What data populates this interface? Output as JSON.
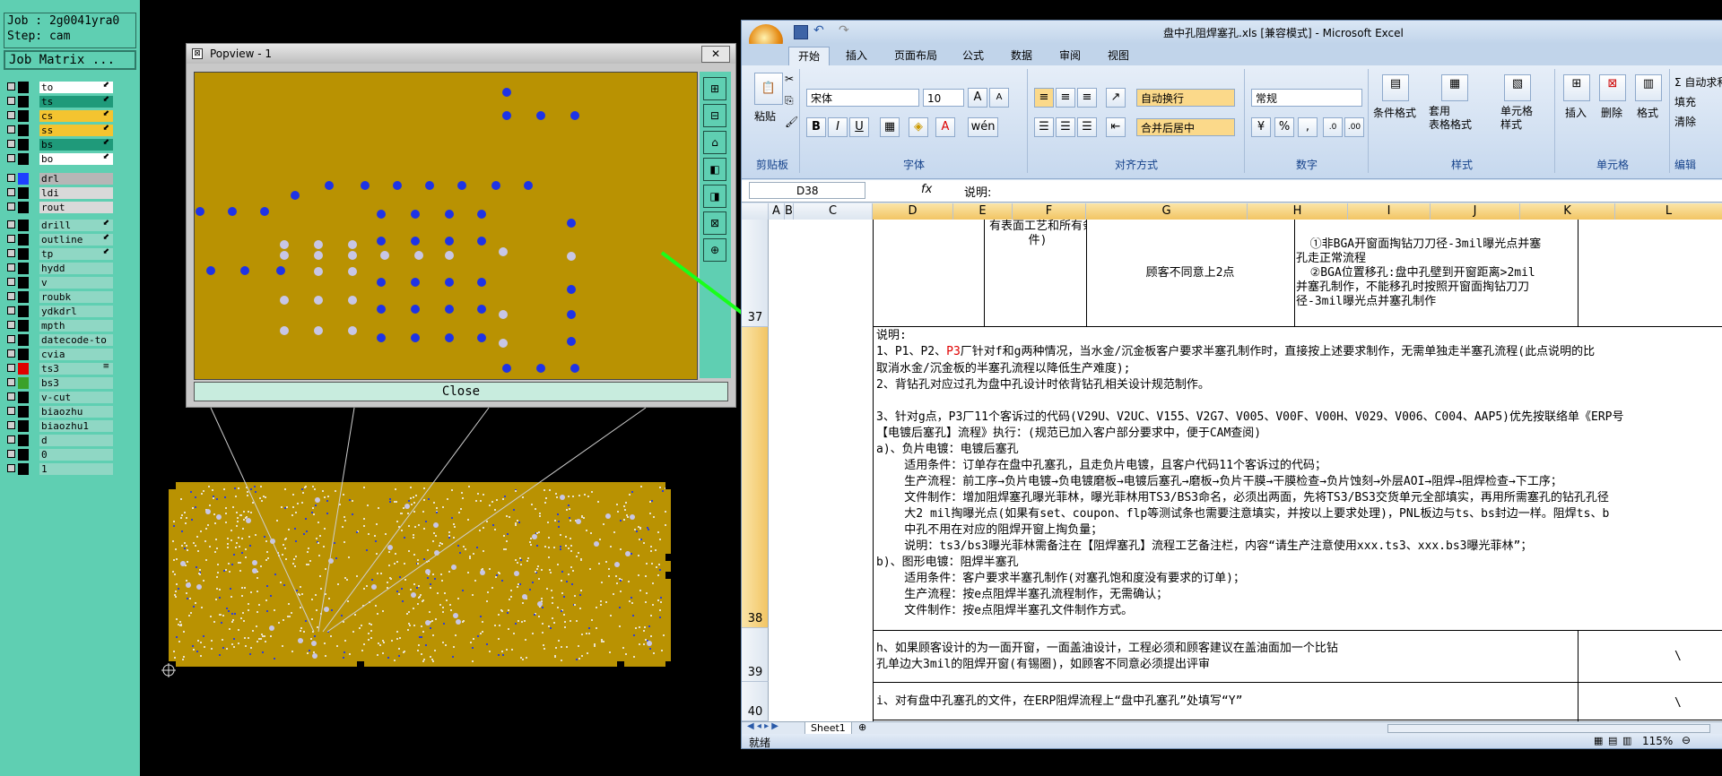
{
  "left_panel": {
    "job_label": "Job : 2g0041yra0",
    "step_label": "Step: cam",
    "job_matrix_label": "Job Matrix ...",
    "layers": [
      {
        "name": "to",
        "color": "#ffffff",
        "swatch": "#000000",
        "flag": "⬋"
      },
      {
        "name": "ts",
        "color": "#1f9a7a",
        "swatch": "#000000",
        "flag": "⬋"
      },
      {
        "name": "cs",
        "color": "#f4c430",
        "swatch": "#000000",
        "flag": "⬋"
      },
      {
        "name": "ss",
        "color": "#f4c430",
        "swatch": "#000000",
        "flag": "⬋"
      },
      {
        "name": "bs",
        "color": "#1f9a7a",
        "swatch": "#000000",
        "flag": "⬋"
      },
      {
        "name": "bo",
        "color": "#ffffff",
        "swatch": "#000000",
        "flag": "⬋"
      },
      {
        "name": "drl",
        "color": "#b6b6b6",
        "swatch": "#1e40ff",
        "flag": ""
      },
      {
        "name": "ldi",
        "color": "#d9d9d9",
        "swatch": "#000000",
        "flag": ""
      },
      {
        "name": "rout",
        "color": "#d9d9d9",
        "swatch": "#000000",
        "flag": ""
      },
      {
        "name": "drill",
        "color": "#8fd7c4",
        "swatch": "#000000",
        "flag": "⬋"
      },
      {
        "name": "outline",
        "color": "#8fd7c4",
        "swatch": "#000000",
        "flag": "⬋"
      },
      {
        "name": "tp",
        "color": "#8fd7c4",
        "swatch": "#000000",
        "flag": "⬋"
      },
      {
        "name": "hydd",
        "color": "#8fd7c4",
        "swatch": "#000000",
        "flag": ""
      },
      {
        "name": "v",
        "color": "#8fd7c4",
        "swatch": "#000000",
        "flag": ""
      },
      {
        "name": "roubk",
        "color": "#8fd7c4",
        "swatch": "#000000",
        "flag": ""
      },
      {
        "name": "ydkdrl",
        "color": "#8fd7c4",
        "swatch": "#000000",
        "flag": ""
      },
      {
        "name": "mpth",
        "color": "#8fd7c4",
        "swatch": "#000000",
        "flag": ""
      },
      {
        "name": "datecode-to",
        "color": "#8fd7c4",
        "swatch": "#000000",
        "flag": ""
      },
      {
        "name": "cvia",
        "color": "#8fd7c4",
        "swatch": "#000000",
        "flag": ""
      },
      {
        "name": "ts3",
        "color": "#8fd7c4",
        "swatch": "#e00000",
        "flag": "≡"
      },
      {
        "name": "bs3",
        "color": "#8fd7c4",
        "swatch": "#3aa12a",
        "flag": ""
      },
      {
        "name": "v-cut",
        "color": "#8fd7c4",
        "swatch": "#000000",
        "flag": ""
      },
      {
        "name": "biaozhu",
        "color": "#8fd7c4",
        "swatch": "#000000",
        "flag": ""
      },
      {
        "name": "biaozhu1",
        "color": "#8fd7c4",
        "swatch": "#000000",
        "flag": ""
      },
      {
        "name": "d",
        "color": "#8fd7c4",
        "swatch": "#000000",
        "flag": ""
      },
      {
        "name": "0",
        "color": "#8fd7c4",
        "swatch": "#000000",
        "flag": ""
      },
      {
        "name": "1",
        "color": "#8fd7c4",
        "swatch": "#000000",
        "flag": ""
      }
    ]
  },
  "popview": {
    "title": "Popview - 1",
    "close_glyph": "✕",
    "close_button": "Close"
  },
  "excel": {
    "title": "盘中孔阻焊塞孔.xls [兼容模式] - Microsoft Excel",
    "tabs": [
      "开始",
      "插入",
      "页面布局",
      "公式",
      "数据",
      "审阅",
      "视图"
    ],
    "ribbon": {
      "paste": "粘贴",
      "font_name": "宋体",
      "font_size": "10",
      "wrap_text": "自动换行",
      "merge_center": "合并后居中",
      "number_format": "常规",
      "cond_format": "条件格式",
      "table_format": "套用\n表格格式",
      "cell_styles": "单元格\n样式",
      "insert": "插入",
      "delete": "删除",
      "format": "格式",
      "autosum": "Σ 自动求和",
      "fill": "填充",
      "clear": "清除",
      "groups": {
        "clipboard": "剪贴板",
        "font": "字体",
        "align": "对齐方式",
        "number": "数字",
        "styles": "样式",
        "cells": "单元格",
        "edit": "编辑"
      }
    },
    "name_box": "D38",
    "fx": "fx",
    "formula": "说明:",
    "columns": [
      "A",
      "B",
      "C",
      "D",
      "E",
      "F",
      "G",
      "H",
      "I",
      "J",
      "K",
      "L"
    ],
    "rows": [
      "37",
      "38",
      "39",
      "40"
    ],
    "cells": {
      "r37_e": "有表面工艺和所有条\n件)",
      "r37_g": "顾客不同意上2点",
      "r37_i": "  ①非BGA开窗面掏钻刀刀径-3mil曝光点并塞\n孔走正常流程\n  ②BGA位置移孔:盘中孔壁到开窗距离>2mil\n并塞孔制作，不能移孔时按照开窗面掏钻刀刀\n径-3mil曝光点并塞孔制作",
      "r38_title": "说明:",
      "r38_l1a": "1、P1、P2、",
      "r38_l1b": "P3",
      "r38_l1c": "厂针对f和g两种情况，当水金/沉金板客户要求半塞孔制作时，直接按上述要求制作，无需单独走半塞孔流程(此点说明的比",
      "r38_body": "取消水金/沉金板的半塞孔流程以降低生产难度);\n2、背钻孔对应过孔为盘中孔设计时依背钻孔相关设计规范制作。\n\n3、针对g点，P3厂11个客诉过的代码(V29U、V2UC、V155、V2G7、V005、V00F、V00H、V029、V006、C004、AAP5)优先按联络单《ERP号\n【电镀后塞孔】流程》执行：(规范已加入客户部分要求中，便于CAM查阅)\na)、负片电镀：电镀后塞孔\n    适用条件：订单存在盘中孔塞孔，且走负片电镀，且客户代码11个客诉过的代码；\n    生产流程：前工序→负片电镀→负电镀磨板→电镀后塞孔→磨板→负片干膜→干膜检查→负片蚀刻→外层AOI→阻焊→阻焊检查→下工序；\n    文件制作：增加阻焊塞孔曝光菲林，曝光菲林用TS3/BS3命名，必须出两面，先将TS3/BS3交货单元全部填实，再用所需塞孔的钻孔孔径\n    大2 mil掏曝光点(如果有set、coupon、flp等测试条也需要注意填实，并按以上要求处理)，PNL板边与ts、bs封边一样。阻焊ts、b\n    中孔不用在对应的阻焊开窗上掏负量；\n    说明：ts3/bs3曝光菲林需备注在【阻焊塞孔】流程工艺备注栏，内容“请生产注意使用xxx.ts3、xxx.bs3曝光菲林”；\nb)、图形电镀：阻焊半塞孔\n    适用条件：客户要求半塞孔制作(对塞孔饱和度没有要求的订单)；\n    生产流程：按e点阻焊半塞孔流程制作，无需确认；\n    文件制作：按e点阻焊半塞孔文件制作方式。",
      "r39_main": "h、如果顾客设计的为一面开窗，一面盖油设计，工程必须和顾客建议在盖油面加一个比钻\n孔单边大3mil的阻焊开窗(有锡圈)，如顾客不同意必须提出评审",
      "r39_l": "\\",
      "r40_main": "i、对有盘中孔塞孔的文件，在ERP阻焊流程上“盘中孔塞孔”处填写“Y”",
      "r40_l": "\\"
    },
    "sheet_tab": "Sheet1",
    "status": "就绪",
    "zoom": "115%"
  }
}
